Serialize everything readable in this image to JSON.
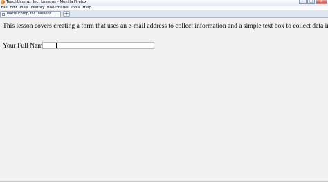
{
  "window": {
    "title": "TeachUcomp, Inc. Lessons - Mozilla Firefox",
    "controls": {
      "minimize": "–",
      "maximize": "□",
      "close": "x"
    }
  },
  "menubar": {
    "items": [
      "File",
      "Edit",
      "View",
      "History",
      "Bookmarks",
      "Tools",
      "Help"
    ]
  },
  "tabs": [
    {
      "label": "TeachUcomp, Inc. Lessons"
    }
  ],
  "new_tab_label": "+",
  "page": {
    "lesson_text": "This lesson covers creating a form that uses an e-mail address to collect information and a simple text box to collect data in.",
    "form": {
      "name_label": "Your Full Name:",
      "name_value": ""
    }
  },
  "icons": {
    "app": "firefox-icon",
    "tab": "page-icon",
    "cursor": "text-cursor-icon"
  }
}
